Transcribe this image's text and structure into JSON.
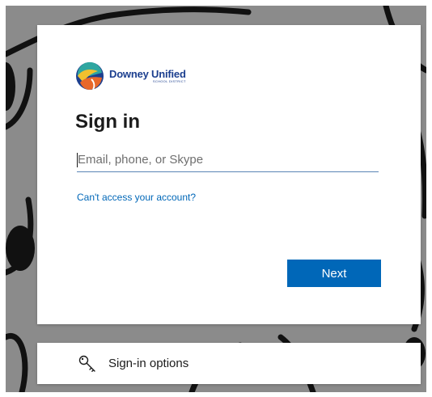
{
  "brand": {
    "name": "Downey Unified",
    "subtitle": "SCHOOL DISTRICT",
    "colors": {
      "primary": "#1c3f8f",
      "orange": "#e8672a",
      "yellow": "#f2c12e",
      "teal": "#2fa6a0"
    }
  },
  "signin": {
    "title": "Sign in",
    "email_placeholder": "Email, phone, or Skype",
    "email_value": "",
    "cant_access_link": "Can't access your account?",
    "next_label": "Next"
  },
  "options": {
    "label": "Sign-in options",
    "icon": "key-icon"
  },
  "colors": {
    "accent": "#0067b8",
    "background": "#8b8b8b"
  }
}
